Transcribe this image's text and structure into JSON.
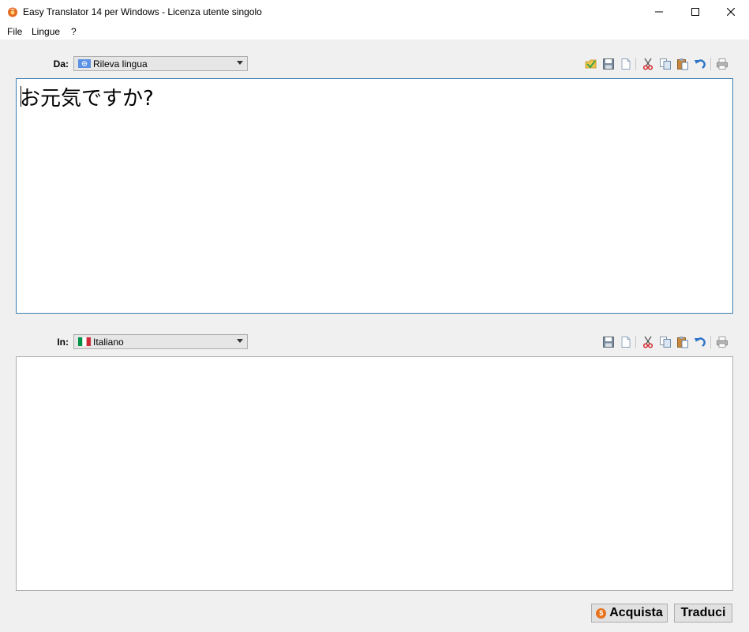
{
  "window": {
    "title": "Easy Translator 14 per Windows - Licenza utente singolo",
    "icon": "app-logo-icon"
  },
  "menu": {
    "items": [
      "File",
      "Lingue",
      "?"
    ]
  },
  "source": {
    "label": "Da:",
    "language": "Rileva lingua",
    "flag": "un-flag-icon",
    "text": "お元気ですか?"
  },
  "target": {
    "label": "In:",
    "language": "Italiano",
    "flag": "italy-flag-icon",
    "text": ""
  },
  "toolbar_source": [
    "open-folder-icon",
    "save-icon",
    "new-document-icon",
    "cut-icon",
    "copy-icon",
    "paste-icon",
    "undo-icon",
    "print-icon"
  ],
  "toolbar_target": [
    "save-icon",
    "new-document-icon",
    "cut-icon",
    "copy-icon",
    "paste-icon",
    "undo-icon",
    "print-icon"
  ],
  "buttons": {
    "buy": "Acquista",
    "translate": "Traduci"
  },
  "colors": {
    "accent_border": "#3c7fb1",
    "coin": "#e8731c"
  }
}
